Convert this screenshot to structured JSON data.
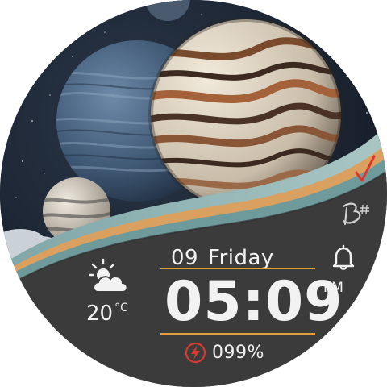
{
  "watch_face": {
    "date": {
      "day": "09",
      "weekday": "Friday"
    },
    "time": {
      "value": "05:09",
      "ampm": "PM"
    },
    "weather": {
      "icon": "partly-cloudy-icon",
      "temperature": "20",
      "unit": "°C"
    },
    "battery": {
      "icon": "charging-bolt-icon",
      "level_text": "099%",
      "level": 0.99
    },
    "complications": {
      "alarm_icon": "bell-icon",
      "brand_icon": "brand-logo-icon",
      "check_icon": "check-mark-icon"
    },
    "colors": {
      "accent_gold": "#e3a03a",
      "bolt_red": "#d93a2f",
      "check_red": "#e0342a",
      "panel_dark": "#3b3b3c",
      "text_light": "#f2f2f2"
    }
  }
}
